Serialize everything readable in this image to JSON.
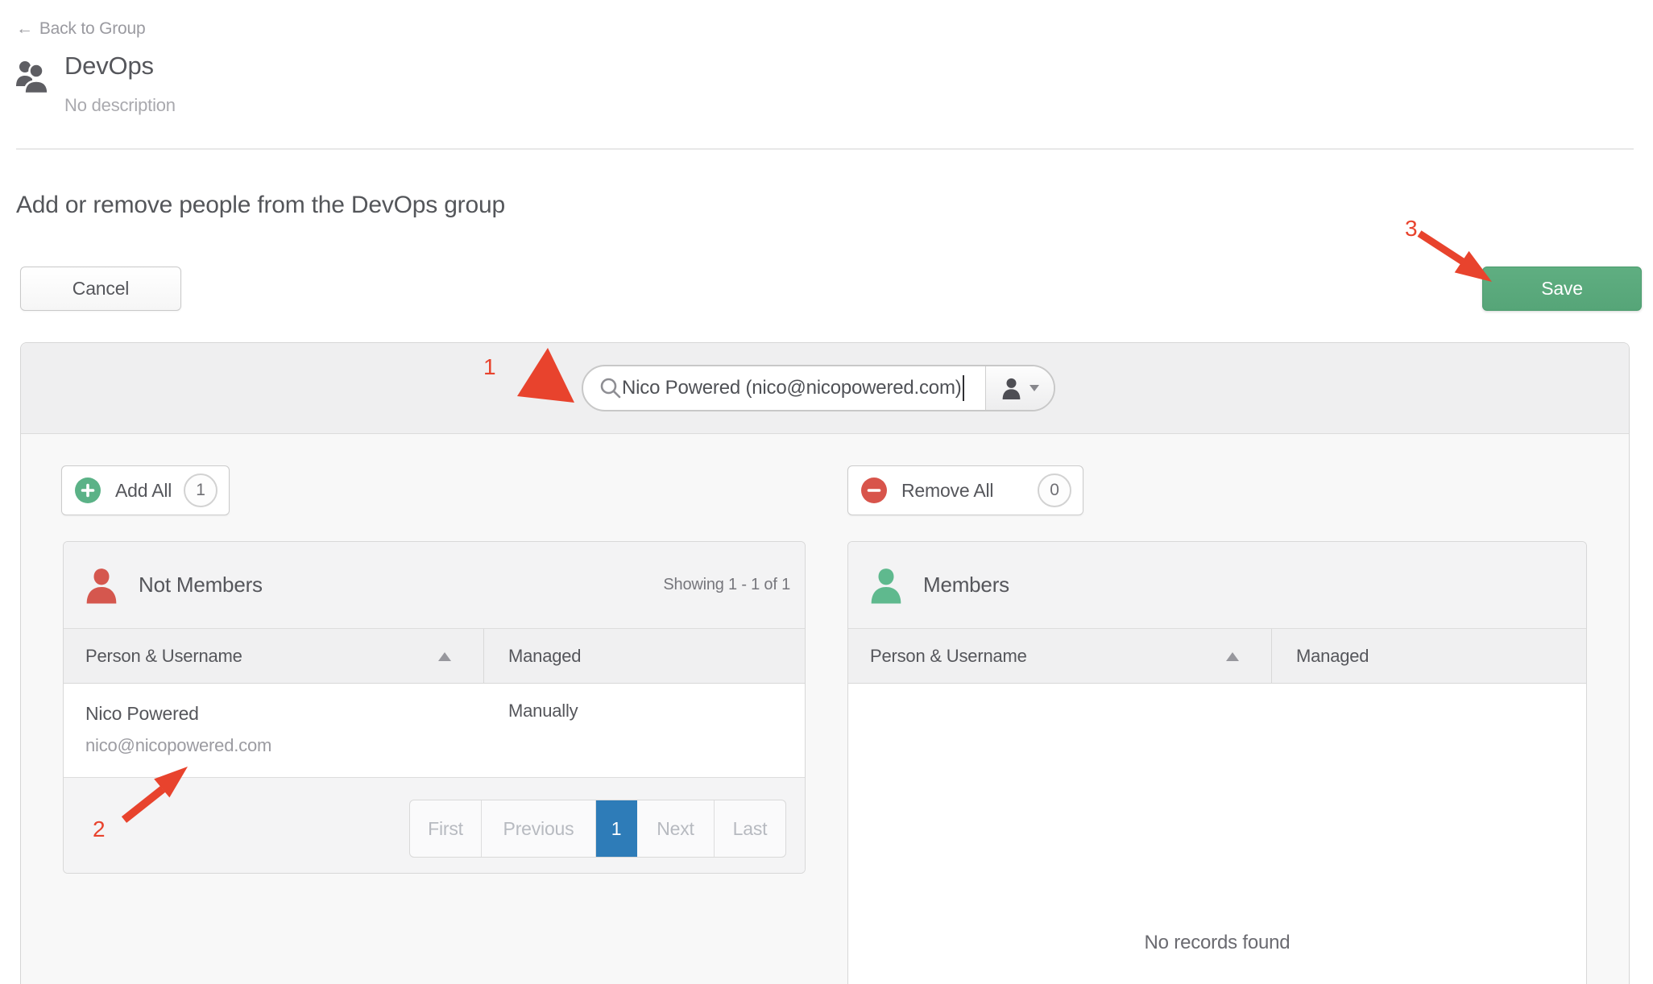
{
  "header": {
    "back_arrow": "←",
    "back_label": "Back to Group",
    "group_name": "DevOps",
    "group_description": "No description"
  },
  "section": {
    "heading": "Add or remove people from the DevOps group",
    "cancel_label": "Cancel",
    "save_label": "Save"
  },
  "annotations": {
    "step1": "1",
    "step2": "2",
    "step3": "3"
  },
  "search": {
    "value": "Nico Powered (nico@nicopowered.com)"
  },
  "toolbar": {
    "add_all_label": "Add All",
    "add_all_count": "1",
    "remove_all_label": "Remove All",
    "remove_all_count": "0"
  },
  "not_members": {
    "title": "Not Members",
    "showing": "Showing 1 - 1 of 1",
    "columns": [
      "Person & Username",
      "Managed"
    ],
    "rows": [
      {
        "name": "Nico Powered",
        "username": "nico@nicopowered.com",
        "managed": "Manually"
      }
    ],
    "pagination": {
      "first": "First",
      "previous": "Previous",
      "current": "1",
      "next": "Next",
      "last": "Last"
    }
  },
  "members": {
    "title": "Members",
    "columns": [
      "Person & Username",
      "Managed"
    ],
    "empty_text": "No records found"
  },
  "colors": {
    "accent_green": "#58a97c",
    "accent_red": "#d5574e",
    "annotation_red": "#e8432d",
    "pagination_active_blue": "#2e7cb8"
  }
}
